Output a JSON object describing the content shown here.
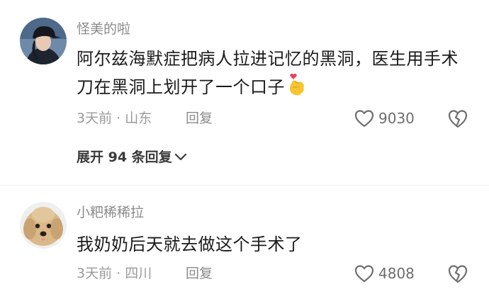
{
  "comments": [
    {
      "username": "怪美的啦",
      "content": "阿尔兹海默症把病人拉进记忆的黑洞，医生用手术刀在黑洞上划开了一个口子",
      "emoji": "finger-heart-emoji",
      "meta": "3天前 · 山东",
      "reply_label": "回复",
      "likes": "9030",
      "expand_label": "展开 94 条回复",
      "avatar": "woman-in-dark-cap-avatar"
    },
    {
      "username": "小粑稀稀拉",
      "content": "我奶奶后天就去做这个手术了",
      "meta": "3天前 · 四川",
      "reply_label": "回复",
      "likes": "4808",
      "avatar": "curly-dog-avatar"
    }
  ],
  "icons": {
    "like": "heart-outline-icon",
    "dislike": "broken-heart-icon",
    "expand": "chevron-down-icon"
  }
}
